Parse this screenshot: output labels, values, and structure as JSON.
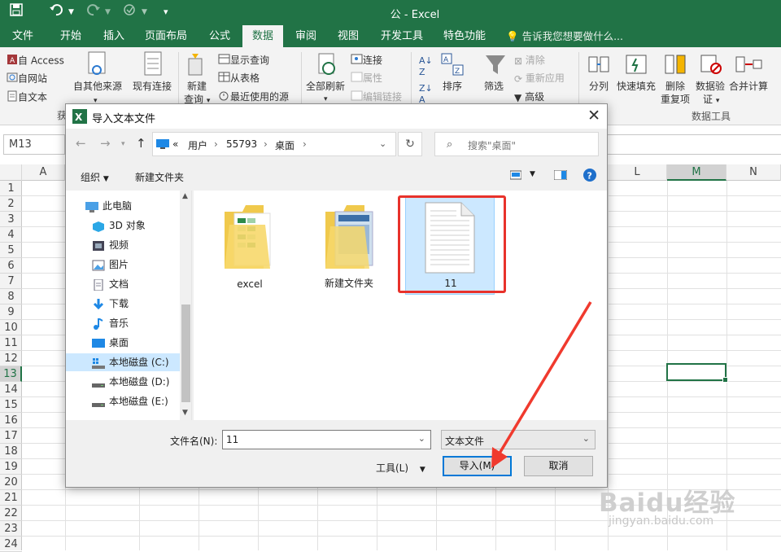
{
  "app": {
    "title": "公 - Excel"
  },
  "tabs": [
    "文件",
    "开始",
    "插入",
    "页面布局",
    "公式",
    "数据",
    "审阅",
    "视图",
    "开发工具",
    "特色功能"
  ],
  "active_tab": "数据",
  "tell_me": "告诉我您想要做什么...",
  "ribbon": {
    "get_external": {
      "access": "自 Access",
      "web": "自网站",
      "text": "自文本",
      "other": "自其他来源",
      "existing": "现有连接",
      "group_fragment": "获"
    },
    "query": {
      "new_query": "新建",
      "new_query2": "查询",
      "show_queries": "显示查询",
      "from_table": "从表格",
      "recent": "最近使用的源"
    },
    "connections": {
      "refresh_all": "全部刷新",
      "connect": "连接",
      "properties": "属性",
      "edit_links": "编辑链接"
    },
    "sort_filter": {
      "sort": "排序",
      "filter": "筛选",
      "clear": "清除",
      "reapply": "重新应用",
      "advanced": "高级"
    },
    "data_tools": {
      "split": "分列",
      "flash_fill": "快速填充",
      "remove_dup1": "删除",
      "remove_dup2": "重复项",
      "validate1": "数据验",
      "validate2": "证",
      "consolidate": "合并计算",
      "group_label": "数据工具"
    }
  },
  "name_box": "M13",
  "columns": [
    "A",
    "L",
    "M",
    "N"
  ],
  "selected_column": "M",
  "rows": [
    "1",
    "2",
    "3",
    "4",
    "5",
    "6",
    "7",
    "8",
    "9",
    "10",
    "11",
    "12",
    "13",
    "14",
    "15",
    "16",
    "17",
    "18",
    "19",
    "20",
    "21",
    "22",
    "23",
    "24"
  ],
  "selected_row": "13",
  "dialog": {
    "title": "导入文本文件",
    "breadcrumb": [
      "«",
      "用户",
      "55793",
      "桌面"
    ],
    "search_placeholder": "搜索\"桌面\"",
    "organize": "组织",
    "new_folder": "新建文件夹",
    "nav_items": [
      "此电脑",
      "3D 对象",
      "视频",
      "图片",
      "文档",
      "下载",
      "音乐",
      "桌面",
      "本地磁盘 (C:)",
      "本地磁盘 (D:)",
      "本地磁盘 (E:)"
    ],
    "selected_nav": "本地磁盘 (C:)",
    "files": [
      "excel",
      "新建文件夹",
      "11"
    ],
    "selected_file": "11",
    "filename_label": "文件名(N):",
    "filename_value": "11",
    "filetype_value": "文本文件",
    "tools_label": "工具(L)",
    "import_button": "导入(M)",
    "cancel_button": "取消"
  },
  "watermark": {
    "brand": "Baidu经验",
    "url": "jingyan.baidu.com"
  },
  "colors": {
    "excel_green": "#217346",
    "highlight_red": "#e8322b",
    "selection_blue": "#cce8ff"
  }
}
